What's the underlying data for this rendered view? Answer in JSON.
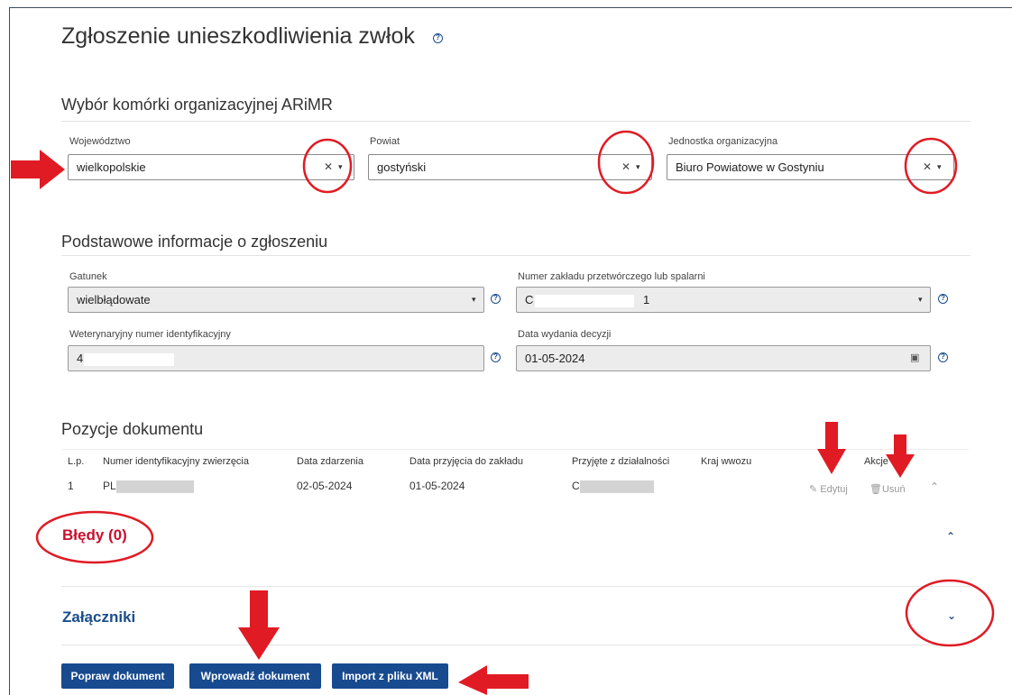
{
  "page": {
    "title": "Zgłoszenie unieszkodliwienia zwłok",
    "help_icon": "question-circle-icon"
  },
  "org_section": {
    "title": "Wybór komórki organizacyjnej ARiMR",
    "voivodeship": {
      "label": "Województwo",
      "value": "wielkopolskie"
    },
    "county": {
      "label": "Powiat",
      "value": "gostyński"
    },
    "unit": {
      "label": "Jednostka organizacyjna",
      "value": "Biuro Powiatowe w Gostyniu"
    }
  },
  "basic_section": {
    "title": "Podstawowe informacje o zgłoszeniu",
    "species": {
      "label": "Gatunek",
      "value": "wielbłądowate"
    },
    "plant_number": {
      "label": "Numer zakładu przetwórczego lub spalarni",
      "value_prefix": "C",
      "value_suffix": "1"
    },
    "vet_number": {
      "label": "Weterynaryjny numer identyfikacyjny",
      "value_prefix": "4"
    },
    "decision_date": {
      "label": "Data wydania decyzji",
      "value": "01-05-2024"
    }
  },
  "positions": {
    "title": "Pozycje dokumentu",
    "headers": {
      "lp": "L.p.",
      "animal_id": "Numer identyfikacyjny zwierzęcia",
      "event_date": "Data zdarzenia",
      "accept_date": "Data przyjęcia do zakładu",
      "from_holding": "Przyjęte z działalności",
      "import_country": "Kraj wwozu",
      "actions": "Akcje"
    },
    "rows": [
      {
        "lp": "1",
        "animal_id_prefix": "PL",
        "event_date": "02-05-2024",
        "accept_date": "01-05-2024",
        "from_holding_prefix": "C",
        "import_country": ""
      }
    ],
    "edit_label": "Edytuj",
    "delete_label": "Usuń"
  },
  "errors": {
    "title": "Błędy (0)"
  },
  "attachments": {
    "title": "Załączniki"
  },
  "buttons": {
    "fix": "Popraw dokument",
    "submit": "Wprowadź dokument",
    "import": "Import z pliku XML"
  },
  "colors": {
    "primary": "#174a8f",
    "error": "#c8102e",
    "annotation": "#e01b24"
  }
}
